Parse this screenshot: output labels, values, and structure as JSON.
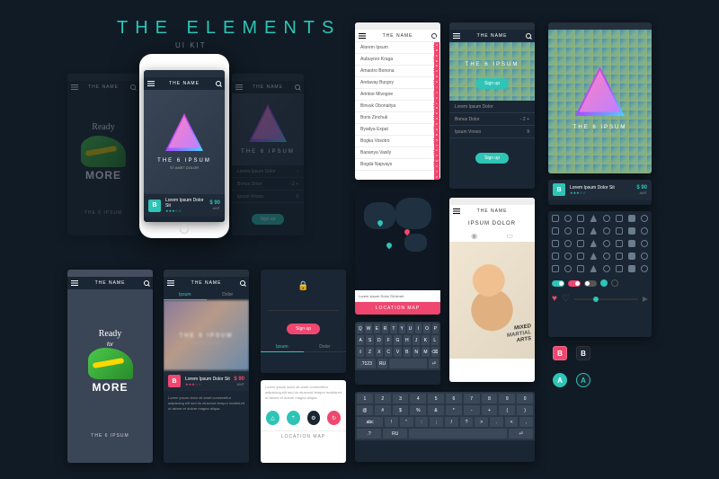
{
  "header": {
    "title": "THE ELEMENTS",
    "subtitle": "UI KIT"
  },
  "app": {
    "name": "THE NAME"
  },
  "hero": {
    "title": "THE 6 IPSUM",
    "subtitle": "ST AMET DOLOR"
  },
  "shoe": {
    "ready": "Ready",
    "for": "for",
    "more": "MORE"
  },
  "card": {
    "badge": "B",
    "title": "Lorem Ipsum Dolor Sit",
    "stars": "★★★☆☆",
    "price": "$ 90",
    "amt": "AMT"
  },
  "signup": "Sign up",
  "form": {
    "r1": {
      "label": "Lorem Ipsum Dolor"
    },
    "r2": {
      "label": "Bonus Dolor",
      "val": "- 2 +"
    },
    "r3": {
      "label": "Ipsum Vnovo",
      "val": "9"
    }
  },
  "contacts": [
    "Alorem Ipsum",
    "Aubuyoro Kraga",
    "Amaotro Bonona",
    "Aretavay Burgoy",
    "Arintoe Mivogoe",
    "Binvuk Obonaitya",
    "Boris Zinchuk",
    "Byadya Expat",
    "Bogka Vosotro",
    "Baoanya Vasily",
    "Bogda Napvays"
  ],
  "letters": [
    "A",
    "B",
    "C",
    "D",
    "E",
    "F",
    "G",
    "H",
    "I",
    "J",
    "K",
    "L",
    "M",
    "N",
    "O",
    "P",
    "Q",
    "R",
    "S",
    "T",
    "U",
    "V",
    "W",
    "X",
    "Y",
    "Z"
  ],
  "map": {
    "info": "Lorem Ipsum Dolor Sit Amet",
    "button": "LOCATION MAP"
  },
  "keyboard": {
    "r1": [
      "Q",
      "W",
      "E",
      "R",
      "T",
      "Y",
      "U",
      "I",
      "O",
      "P"
    ],
    "r2": [
      "A",
      "S",
      "D",
      "F",
      "G",
      "H",
      "J",
      "K",
      "L"
    ],
    "r3": [
      "⇧",
      "Z",
      "X",
      "C",
      "V",
      "B",
      "N",
      "M",
      "⌫"
    ],
    "r4": [
      ".?123",
      "RU",
      "space",
      "⏎"
    ],
    "sym1": [
      "1",
      "2",
      "3",
      "4",
      "5",
      "6",
      "7",
      "8",
      "9",
      "0"
    ],
    "sym2": [
      "@",
      "#",
      "$",
      "%",
      "&",
      "*",
      "-",
      "+",
      "(",
      ")"
    ],
    "sym3": [
      "abc",
      "!",
      "\"",
      ":",
      ";",
      "/",
      "?",
      ">",
      ".",
      "<",
      ","
    ],
    "sym4": [
      ".?",
      "RU",
      "space",
      "⏎"
    ]
  },
  "tabs": {
    "ipsum": "Ipsum",
    "dolor": "Dolor"
  },
  "lorem": "Lorem ipsum dolor sit amet consectetur adipiscing elit sed do eiusmod tempor incididunt ut labore et dolore magna aliqua.",
  "profile": {
    "title": "IPSUM DOLOR"
  },
  "tags": {
    "mixed": "MIXED",
    "martial": "MARTIAL",
    "arts": "ARTS"
  },
  "swat": {
    "b": "B",
    "a": "A",
    "a2": "A"
  },
  "colors": {
    "teal": "#2ec4b6",
    "pink": "#ef476f",
    "navy": "#1a2633",
    "dark": "#111b25"
  }
}
